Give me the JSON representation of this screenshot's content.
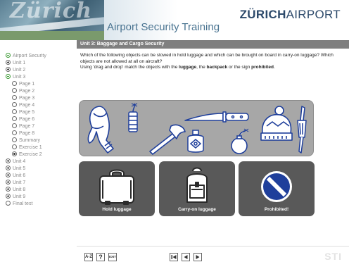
{
  "header": {
    "banner_text": "Zürich",
    "title": "Airport Security Training",
    "brand_strong": "ZÜRICH",
    "brand_light": "AIRPORT"
  },
  "unit_bar": {
    "text": "Unit 3: Baggage and Cargo Security"
  },
  "sidebar": {
    "items": [
      {
        "label": "Airport Security",
        "icon": "minus-green-icon"
      },
      {
        "label": "Unit 1",
        "icon": "plus-icon"
      },
      {
        "label": "Unit 2",
        "icon": "plus-icon"
      },
      {
        "label": "Unit 3",
        "icon": "minus-green-icon"
      },
      {
        "label": "Page 1",
        "icon": "empty-circle-icon"
      },
      {
        "label": "Page 2",
        "icon": "empty-circle-icon"
      },
      {
        "label": "Page 3",
        "icon": "empty-circle-icon"
      },
      {
        "label": "Page 4",
        "icon": "empty-circle-icon"
      },
      {
        "label": "Page 5",
        "icon": "empty-circle-icon"
      },
      {
        "label": "Page 6",
        "icon": "empty-circle-icon"
      },
      {
        "label": "Page 7",
        "icon": "empty-circle-icon"
      },
      {
        "label": "Page 8",
        "icon": "empty-circle-icon"
      },
      {
        "label": "Summary",
        "icon": "empty-circle-icon"
      },
      {
        "label": "Exercise 1",
        "icon": "empty-circle-icon"
      },
      {
        "label": "Exercise 2",
        "icon": "selected-circle-icon"
      },
      {
        "label": "Unit 4",
        "icon": "plus-icon"
      },
      {
        "label": "Unit 5",
        "icon": "plus-icon"
      },
      {
        "label": "Unit 6",
        "icon": "plus-icon"
      },
      {
        "label": "Unit 7",
        "icon": "plus-icon"
      },
      {
        "label": "Unit 8",
        "icon": "plus-icon"
      },
      {
        "label": "Unit 9",
        "icon": "plus-icon"
      },
      {
        "label": "Final test",
        "icon": "empty-circle-icon"
      }
    ]
  },
  "instructions": {
    "line1": "Which of the following objects can be stowed in hold luggage and which can be brought on board in carry-on luggage? Which objects are not allowed at all on aircraft?",
    "line2_prefix": "Using 'drag and drop' match the objects with the ",
    "line2_luggage": "luggage",
    "line2_mid": ", the ",
    "line2_backpack": "backpack",
    "line2_or": " or the sign ",
    "line2_prohibited": "prohibited",
    "line2_end": "."
  },
  "objects": [
    "scarf",
    "firecracker",
    "axe",
    "knife",
    "gas-canister",
    "bomb",
    "wool-hat",
    "screwdriver"
  ],
  "targets": {
    "hold": {
      "label": "Hold luggage",
      "icon": "suitcase-icon"
    },
    "carry": {
      "label": "Carry-on luggage",
      "icon": "backpack-icon"
    },
    "prohibited": {
      "label": "Prohibited!",
      "icon": "prohibited-icon"
    }
  },
  "footer": {
    "az_label": "A-Z",
    "help_label": "?",
    "exit_label": "EXIT",
    "first_icon": "first-page-icon",
    "prev_icon": "previous-icon",
    "next_icon": "next-icon",
    "logo_text": "STI"
  },
  "colors": {
    "unit_bar": "#7f7f7f",
    "objects_panel": "#a7a7a7",
    "target_box": "#595959",
    "prohibited_blue": "#1f3f9b",
    "tree_green": "#3d9b35"
  }
}
